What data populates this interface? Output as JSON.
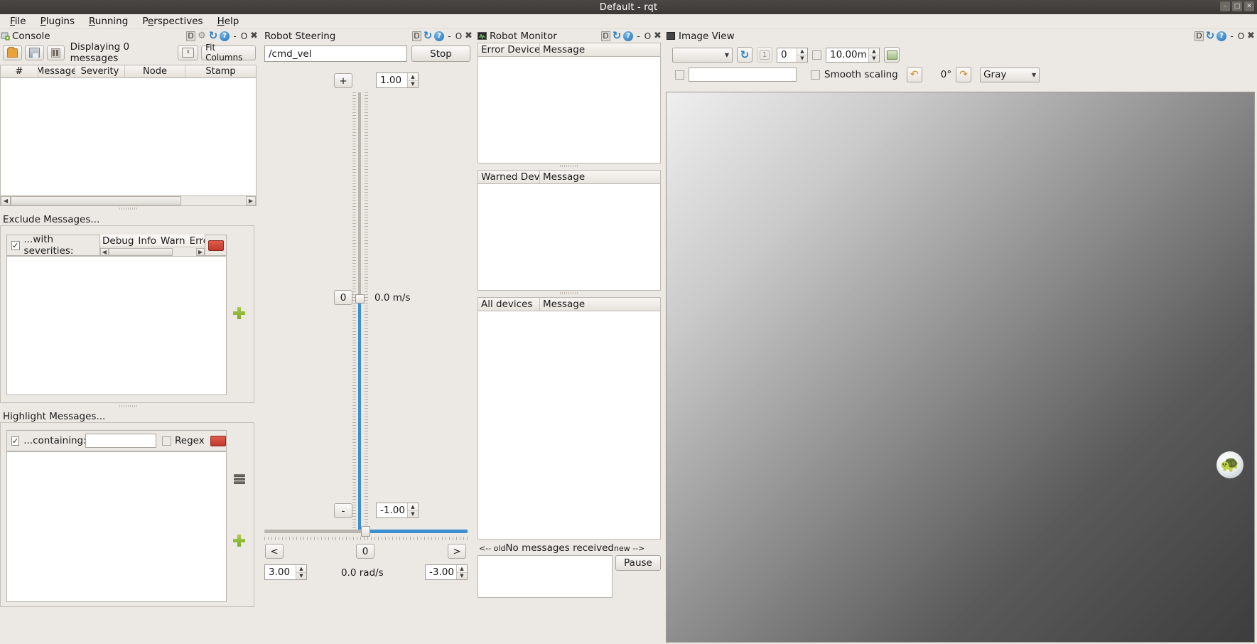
{
  "window": {
    "title": "Default - rqt",
    "buttons": [
      "minimize",
      "maximize",
      "close"
    ],
    "button_glyphs": [
      "–",
      "□",
      "✕"
    ]
  },
  "menubar": {
    "items": [
      {
        "label": "File",
        "mnemonic": "F"
      },
      {
        "label": "Plugins",
        "mnemonic": "P"
      },
      {
        "label": "Running",
        "mnemonic": "R"
      },
      {
        "label": "Perspectives",
        "mnemonic": "e"
      },
      {
        "label": "Help",
        "mnemonic": "H"
      }
    ]
  },
  "dock_controls": {
    "dockable": "D",
    "minimize": "-",
    "maximize": "O",
    "close": "✖"
  },
  "console": {
    "title": "Console",
    "toolbar": {
      "open_icon": "folder-open-icon",
      "save_icon": "save-icon",
      "pause_icon": "pause-icon",
      "status": "Displaying 0 messages",
      "clear_icon": "clear-icon",
      "fit_columns": "Fit Columns"
    },
    "table": {
      "columns": [
        "#",
        "Message",
        "Severity",
        "Node",
        "Stamp"
      ],
      "rows": []
    },
    "exclude": {
      "label": "Exclude Messages...",
      "checkbox_checked": true,
      "filter_label": "...with severities:",
      "severities": [
        "Debug",
        "Info",
        "Warn",
        "Error"
      ],
      "remove_icon": "remove-filter-icon",
      "add_icon": "add-filter-icon"
    },
    "highlight": {
      "label": "Highlight Messages...",
      "checkbox_checked": true,
      "filter_label": "...containing:",
      "text_value": "",
      "regex_label": "Regex",
      "regex_checked": false,
      "remove_icon": "remove-filter-icon",
      "stack_icon": "stack-filter-icon",
      "add_icon": "add-filter-icon"
    }
  },
  "steering": {
    "title": "Robot Steering",
    "topic": "/cmd_vel",
    "topic_placeholder": "/cmd_vel",
    "stop_button": "Stop",
    "linear": {
      "increase_button": "+",
      "decrease_button": "-",
      "zero_button": "0",
      "max_value": "1.00",
      "min_value": "-1.00",
      "readout": "0.0 m/s",
      "current": 0.0
    },
    "angular": {
      "left_button": "<",
      "right_button": ">",
      "zero_button": "0",
      "max_value": "3.00",
      "min_value": "-3.00",
      "readout": "0.0 rad/s",
      "current": 0.0
    }
  },
  "monitor": {
    "title": "Robot Monitor",
    "error_table": {
      "columns": [
        "Error Device",
        "Message"
      ],
      "rows": []
    },
    "warn_table": {
      "columns": [
        "Warned Device",
        "Message"
      ],
      "rows": []
    },
    "all_table": {
      "columns": [
        "All devices",
        "Message"
      ],
      "rows": []
    },
    "status": {
      "old_label": "<-- old",
      "message": "No messages received",
      "new_label": "new -->"
    },
    "pause_button": "Pause"
  },
  "image_view": {
    "title": "Image View",
    "topic_value": "",
    "refresh_icon": "refresh-icon",
    "numbered_icon": "frame-number-icon",
    "index_value": "0",
    "dynamic_range_checked": false,
    "range_value": "10.00m",
    "save_icon": "save-image-icon",
    "publish_checkbox_checked": false,
    "publish_topic_value": "",
    "smooth_scaling_label": "Smooth scaling",
    "smooth_scaling_checked": false,
    "rotate_ccw_icon": "rotate-ccw-icon",
    "rotation_value": "0°",
    "rotate_cw_icon": "rotate-cw-icon",
    "colormap_value": "Gray",
    "logo": "turtle-logo"
  },
  "colors": {
    "window_bg": "#ece9e4",
    "titlebar": "#3b3835",
    "accent_blue": "#3b8ed0",
    "filter_red": "#c0392b",
    "add_green": "#7fa82c"
  }
}
